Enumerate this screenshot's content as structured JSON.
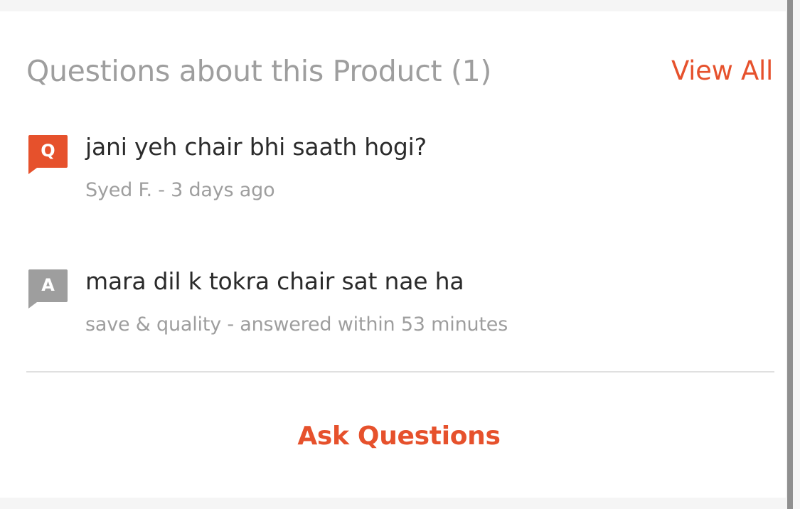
{
  "header": {
    "title": "Questions about this Product (1)",
    "view_all_label": "View All"
  },
  "question": {
    "badge": "Q",
    "text": "jani yeh chair bhi saath hogi?",
    "meta": "Syed F. - 3  days ago",
    "badge_color": "#e6512c"
  },
  "answer": {
    "badge": "A",
    "text": "mara dil k tokra chair sat nae ha",
    "meta": "save & quality - answered within 53  minutes",
    "badge_color": "#9e9e9e"
  },
  "footer": {
    "ask_label": "Ask Questions"
  },
  "colors": {
    "accent": "#e6512c",
    "muted_text": "#9e9e9e",
    "body_text": "#2b2b2b"
  },
  "icons": {
    "question_badge": "speech-bubble-q-icon",
    "answer_badge": "speech-bubble-a-icon"
  }
}
